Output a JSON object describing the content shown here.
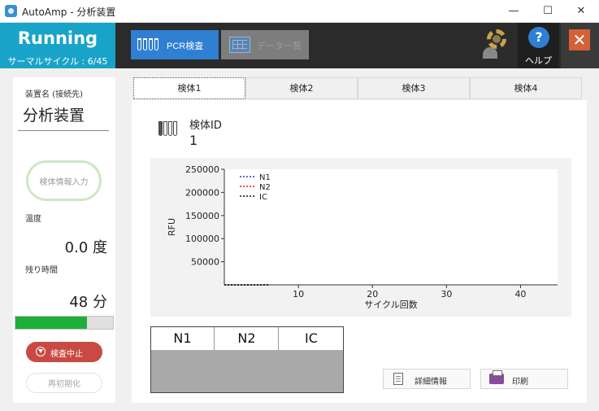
{
  "window": {
    "title": "AutoAmp - 分析装置",
    "minimize": "—",
    "maximize": "☐",
    "close": "✕"
  },
  "header": {
    "status": "Running",
    "cycle": "サーマルサイクル : 6/45",
    "pcr_button": "PCR検査",
    "data_button": "データ一覧",
    "help_label": "ヘルプ",
    "help_glyph": "?",
    "close_glyph": "✕",
    "accent": "#1aa3c8"
  },
  "left": {
    "device_label": "装置名 (接続先)",
    "device_name": "分析装置",
    "sample_info_button": "検体情報入力",
    "temp_label": "温度",
    "temp_value": "0.0 度",
    "remaining_label": "残り時間",
    "remaining_value": "48 分",
    "progress_fraction": 0.73,
    "stop_button": "検査中止",
    "reinit_button": "再初期化"
  },
  "tabs": [
    "検体1",
    "検体2",
    "検体3",
    "検体4"
  ],
  "sample": {
    "id_label": "検体ID",
    "id_value": "1"
  },
  "chart_data": {
    "type": "line",
    "xlabel": "サイクル回数",
    "ylabel": "RFU",
    "xlim": [
      0,
      45
    ],
    "ylim": [
      0,
      250000
    ],
    "xticks": [
      10,
      20,
      30,
      40
    ],
    "yticks": [
      50000,
      100000,
      150000,
      200000,
      250000
    ],
    "ytick_labels": [
      "50000",
      "100000",
      "150000",
      "200000",
      "250000"
    ],
    "legend_position": "top-left",
    "series": [
      {
        "name": "N1",
        "color": "#2233cc",
        "x": [
          0,
          1,
          2,
          3,
          4,
          5,
          6
        ],
        "y": [
          0,
          0,
          0,
          0,
          0,
          0,
          0
        ]
      },
      {
        "name": "N2",
        "color": "#dd2222",
        "x": [
          0,
          1,
          2,
          3,
          4,
          5,
          6
        ],
        "y": [
          0,
          0,
          0,
          0,
          0,
          0,
          0
        ]
      },
      {
        "name": "IC",
        "color": "#111111",
        "x": [
          0,
          1,
          2,
          3,
          4,
          5,
          6
        ],
        "y": [
          0,
          0,
          0,
          0,
          0,
          0,
          0
        ]
      }
    ]
  },
  "results": {
    "headers": [
      "N1",
      "N2",
      "IC"
    ]
  },
  "actions": {
    "detail_button": "詳細情報",
    "print_button": "印刷"
  }
}
